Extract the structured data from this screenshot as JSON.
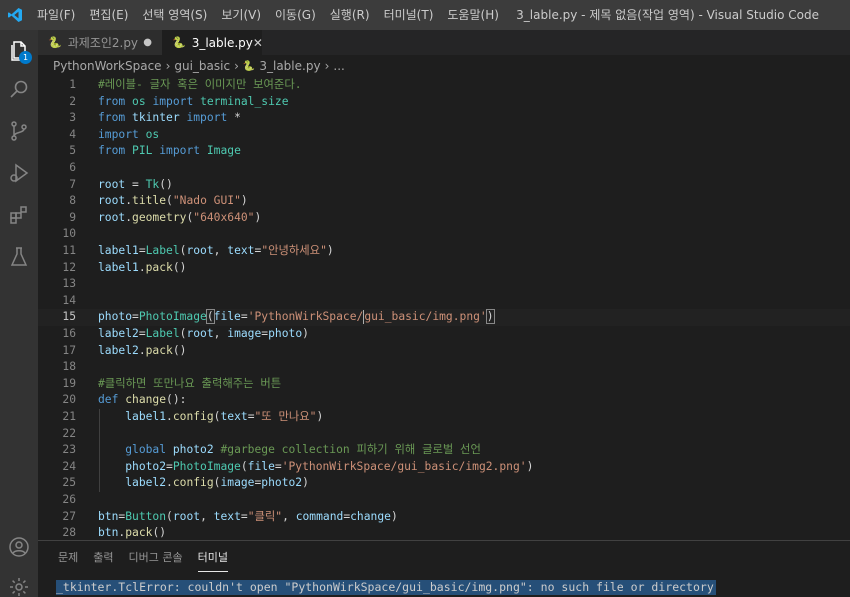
{
  "window": {
    "title": "3_lable.py - 제목 없음(작업 영역) - Visual Studio Code"
  },
  "menu": [
    "파일(F)",
    "편집(E)",
    "선택 영역(S)",
    "보기(V)",
    "이동(G)",
    "실행(R)",
    "터미널(T)",
    "도움말(H)"
  ],
  "activity": {
    "explorer_badge": "1",
    "icons": [
      "files-icon",
      "search-icon",
      "source-control-icon",
      "run-debug-icon",
      "extensions-icon",
      "testing-icon",
      "account-icon",
      "settings-gear-icon"
    ]
  },
  "tabs": [
    {
      "label": "과제조인2.py",
      "modified": true,
      "active": false
    },
    {
      "label": "3_lable.py",
      "modified": false,
      "active": true
    }
  ],
  "tab_glyphs": {
    "modified_dot": "●",
    "close": "✕",
    "python": "🐍"
  },
  "breadcrumb": {
    "items": [
      "PythonWorkSpace",
      "gui_basic",
      "3_lable.py",
      "..."
    ],
    "separator": "›"
  },
  "editor": {
    "current_line": 15,
    "lines": [
      {
        "n": "1",
        "tokens": [
          [
            "c",
            "#레이블- 글자 혹은 이미지만 보여준다."
          ]
        ]
      },
      {
        "n": "2",
        "tokens": [
          [
            "k",
            "from"
          ],
          [
            "p",
            " "
          ],
          [
            "t",
            "os"
          ],
          [
            "p",
            " "
          ],
          [
            "k",
            "import"
          ],
          [
            "p",
            " "
          ],
          [
            "t",
            "terminal_size"
          ]
        ]
      },
      {
        "n": "3",
        "tokens": [
          [
            "k",
            "from"
          ],
          [
            "p",
            " "
          ],
          [
            "v",
            "tkinter"
          ],
          [
            "p",
            " "
          ],
          [
            "k",
            "import"
          ],
          [
            "p",
            " *"
          ]
        ]
      },
      {
        "n": "4",
        "tokens": [
          [
            "k",
            "import"
          ],
          [
            "p",
            " "
          ],
          [
            "t",
            "os"
          ]
        ]
      },
      {
        "n": "5",
        "tokens": [
          [
            "k",
            "from"
          ],
          [
            "p",
            " "
          ],
          [
            "t",
            "PIL"
          ],
          [
            "p",
            " "
          ],
          [
            "k",
            "import"
          ],
          [
            "p",
            " "
          ],
          [
            "t",
            "Image"
          ]
        ]
      },
      {
        "n": "6",
        "tokens": []
      },
      {
        "n": "7",
        "tokens": [
          [
            "v",
            "root"
          ],
          [
            "p",
            " = "
          ],
          [
            "t",
            "Tk"
          ],
          [
            "p",
            "()"
          ]
        ]
      },
      {
        "n": "8",
        "tokens": [
          [
            "v",
            "root"
          ],
          [
            "p",
            "."
          ],
          [
            "f",
            "title"
          ],
          [
            "p",
            "("
          ],
          [
            "s",
            "\"Nado GUI\""
          ],
          [
            "p",
            ")"
          ]
        ]
      },
      {
        "n": "9",
        "tokens": [
          [
            "v",
            "root"
          ],
          [
            "p",
            "."
          ],
          [
            "f",
            "geometry"
          ],
          [
            "p",
            "("
          ],
          [
            "s",
            "\"640x640\""
          ],
          [
            "p",
            ")"
          ]
        ]
      },
      {
        "n": "10",
        "tokens": []
      },
      {
        "n": "11",
        "tokens": [
          [
            "v",
            "label1"
          ],
          [
            "p",
            "="
          ],
          [
            "t",
            "Label"
          ],
          [
            "p",
            "("
          ],
          [
            "v",
            "root"
          ],
          [
            "p",
            ", "
          ],
          [
            "v",
            "text"
          ],
          [
            "p",
            "="
          ],
          [
            "s",
            "\"안녕하세요\""
          ],
          [
            "p",
            ")"
          ]
        ]
      },
      {
        "n": "12",
        "tokens": [
          [
            "v",
            "label1"
          ],
          [
            "p",
            "."
          ],
          [
            "f",
            "pack"
          ],
          [
            "p",
            "()"
          ]
        ]
      },
      {
        "n": "13",
        "tokens": []
      },
      {
        "n": "14",
        "tokens": []
      },
      {
        "n": "15",
        "tokens": [
          [
            "v",
            "photo"
          ],
          [
            "p",
            "="
          ],
          [
            "t",
            "PhotoImage"
          ],
          [
            "pb",
            "("
          ],
          [
            "v",
            "file"
          ],
          [
            "p",
            "="
          ],
          [
            "s",
            "'PythonWirkSpace/"
          ],
          [
            "cursor",
            ""
          ],
          [
            "s",
            "gui_basic/img.png'"
          ],
          [
            "pb",
            ")"
          ]
        ]
      },
      {
        "n": "16",
        "tokens": [
          [
            "v",
            "label2"
          ],
          [
            "p",
            "="
          ],
          [
            "t",
            "Label"
          ],
          [
            "p",
            "("
          ],
          [
            "v",
            "root"
          ],
          [
            "p",
            ", "
          ],
          [
            "v",
            "image"
          ],
          [
            "p",
            "="
          ],
          [
            "v",
            "photo"
          ],
          [
            "p",
            ")"
          ]
        ]
      },
      {
        "n": "17",
        "tokens": [
          [
            "v",
            "label2"
          ],
          [
            "p",
            "."
          ],
          [
            "f",
            "pack"
          ],
          [
            "p",
            "()"
          ]
        ]
      },
      {
        "n": "18",
        "tokens": []
      },
      {
        "n": "19",
        "tokens": [
          [
            "c",
            "#클릭하면 또만나요 출력해주는 버튼"
          ]
        ]
      },
      {
        "n": "20",
        "tokens": [
          [
            "k",
            "def"
          ],
          [
            "p",
            " "
          ],
          [
            "f",
            "change"
          ],
          [
            "p",
            "():"
          ]
        ]
      },
      {
        "n": "21",
        "tokens": [
          [
            "p",
            "    "
          ],
          [
            "v",
            "label1"
          ],
          [
            "p",
            "."
          ],
          [
            "f",
            "config"
          ],
          [
            "p",
            "("
          ],
          [
            "v",
            "text"
          ],
          [
            "p",
            "="
          ],
          [
            "s",
            "\"또 만나요\""
          ],
          [
            "p",
            ")"
          ]
        ]
      },
      {
        "n": "22",
        "tokens": []
      },
      {
        "n": "23",
        "tokens": [
          [
            "p",
            "    "
          ],
          [
            "k",
            "global"
          ],
          [
            "p",
            " "
          ],
          [
            "v",
            "photo2"
          ],
          [
            "p",
            " "
          ],
          [
            "c",
            "#garbege collection 피하기 위해 글로벌 선언"
          ]
        ]
      },
      {
        "n": "24",
        "tokens": [
          [
            "p",
            "    "
          ],
          [
            "v",
            "photo2"
          ],
          [
            "p",
            "="
          ],
          [
            "t",
            "PhotoImage"
          ],
          [
            "p",
            "("
          ],
          [
            "v",
            "file"
          ],
          [
            "p",
            "="
          ],
          [
            "s",
            "'PythonWirkSpace/gui_basic/img2.png'"
          ],
          [
            "p",
            ")"
          ]
        ]
      },
      {
        "n": "25",
        "tokens": [
          [
            "p",
            "    "
          ],
          [
            "v",
            "label2"
          ],
          [
            "p",
            "."
          ],
          [
            "f",
            "config"
          ],
          [
            "p",
            "("
          ],
          [
            "v",
            "image"
          ],
          [
            "p",
            "="
          ],
          [
            "v",
            "photo2"
          ],
          [
            "p",
            ")"
          ]
        ]
      },
      {
        "n": "26",
        "tokens": []
      },
      {
        "n": "27",
        "tokens": [
          [
            "v",
            "btn"
          ],
          [
            "p",
            "="
          ],
          [
            "t",
            "Button"
          ],
          [
            "p",
            "("
          ],
          [
            "v",
            "root"
          ],
          [
            "p",
            ", "
          ],
          [
            "v",
            "text"
          ],
          [
            "p",
            "="
          ],
          [
            "s",
            "\"클릭\""
          ],
          [
            "p",
            ", "
          ],
          [
            "v",
            "command"
          ],
          [
            "p",
            "="
          ],
          [
            "v",
            "change"
          ],
          [
            "p",
            ")"
          ]
        ]
      },
      {
        "n": "28",
        "tokens": [
          [
            "v",
            "btn"
          ],
          [
            "p",
            "."
          ],
          [
            "f",
            "pack"
          ],
          [
            "p",
            "()"
          ]
        ]
      }
    ]
  },
  "panel": {
    "tabs": [
      {
        "label": "문제",
        "active": false
      },
      {
        "label": "출력",
        "active": false
      },
      {
        "label": "디버그 콘솔",
        "active": false
      },
      {
        "label": "터미널",
        "active": true
      }
    ],
    "terminal_text": "_tkinter.TclError: couldn't open \"PythonWirkSpace/gui_basic/img.png\": no such file or directory"
  },
  "colors": {
    "accent": "#007acc",
    "titlebar": "#3c3c3c",
    "activitybar": "#333333",
    "editor_bg": "#1e1e1e"
  }
}
